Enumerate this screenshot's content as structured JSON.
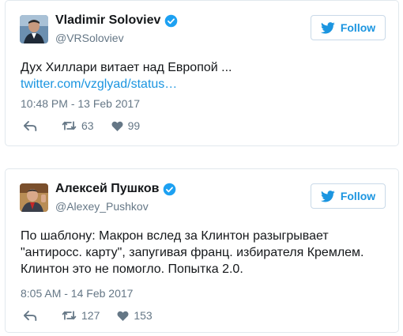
{
  "tweets": [
    {
      "author_name": "Vladimir Soloviev",
      "handle": "@VRSoloviev",
      "follow_label": "Follow",
      "text": "Дух Хиллари витает над Европой ...",
      "link": "twitter.com/vzglyad/status…",
      "timestamp": "10:48 PM - 13 Feb 2017",
      "retweets": "63",
      "likes": "99",
      "avatar_icon": "user-photo-icon"
    },
    {
      "author_name": "Алексей Пушков",
      "handle": "@Alexey_Pushkov",
      "follow_label": "Follow",
      "text_lines": [
        "По шаблону: Макрон вслед за Клинтон разыгрывает",
        "\"антиросс. карту\", запугивая франц. избирателя Кремлем.",
        "Клинтон это не помогло. Попытка 2.0."
      ],
      "timestamp": "8:05 AM - 14 Feb 2017",
      "retweets": "127",
      "likes": "153",
      "avatar_icon": "user-photo-icon"
    }
  ],
  "colors": {
    "accent": "#1b95e0",
    "muted": "#657786",
    "border": "#e1e8ed",
    "verified": "#1da1f2"
  }
}
